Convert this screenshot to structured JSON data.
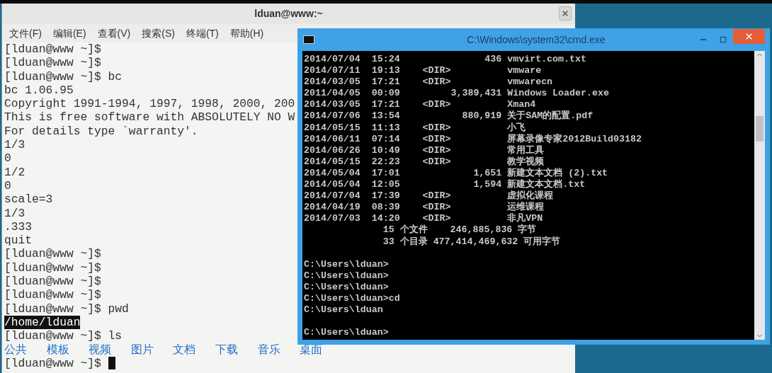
{
  "terminal": {
    "title": "lduan@www:~",
    "menu": [
      "文件(F)",
      "编辑(E)",
      "查看(V)",
      "搜索(S)",
      "终端(T)",
      "帮助(H)"
    ],
    "lines": [
      {
        "kind": "text",
        "text": "[lduan@www ~]$"
      },
      {
        "kind": "text",
        "text": "[lduan@www ~]$"
      },
      {
        "kind": "text",
        "text": "[lduan@www ~]$ bc"
      },
      {
        "kind": "text",
        "text": "bc 1.06.95"
      },
      {
        "kind": "text",
        "text": "Copyright 1991-1994, 1997, 1998, 2000, 200"
      },
      {
        "kind": "text",
        "text": "This is free software with ABSOLUTELY NO W"
      },
      {
        "kind": "text",
        "text": "For details type `warranty'."
      },
      {
        "kind": "text",
        "text": "1/3"
      },
      {
        "kind": "text",
        "text": "0"
      },
      {
        "kind": "text",
        "text": "1/2"
      },
      {
        "kind": "text",
        "text": "0"
      },
      {
        "kind": "text",
        "text": "scale=3"
      },
      {
        "kind": "text",
        "text": "1/3"
      },
      {
        "kind": "text",
        "text": ".333"
      },
      {
        "kind": "text",
        "text": "quit"
      },
      {
        "kind": "text",
        "text": "[lduan@www ~]$"
      },
      {
        "kind": "text",
        "text": "[lduan@www ~]$"
      },
      {
        "kind": "text",
        "text": "[lduan@www ~]$"
      },
      {
        "kind": "text",
        "text": "[lduan@www ~]$"
      },
      {
        "kind": "text",
        "text": "[lduan@www ~]$ pwd"
      },
      {
        "kind": "highlight",
        "text": "/home/lduan"
      },
      {
        "kind": "text",
        "text": "[lduan@www ~]$ ls"
      },
      {
        "kind": "listing",
        "items": [
          "公共",
          "模板",
          "视频",
          "图片",
          "文档",
          "下载",
          "音乐",
          "桌面"
        ]
      },
      {
        "kind": "prompt",
        "text": "[lduan@www ~]$",
        "cursor": true
      }
    ]
  },
  "cmd": {
    "title": "C:\\Windows\\system32\\cmd.exe",
    "blocks": [
      [
        "2014/07/04  15:24               436 vmvirt.com.txt",
        "2014/07/11  19:13    <DIR>          vmware",
        "2014/03/05  17:21    <DIR>          vmwarecn",
        "2011/04/05  00:09         3,389,431 Windows Loader.exe",
        "2014/03/05  17:21    <DIR>          Xman4",
        "2014/07/06  13:54           880,919 关于SAM的配置.pdf",
        "2014/05/15  11:13    <DIR>          小飞",
        "2014/06/11  07:14    <DIR>          屏幕录像专家2012Build03182",
        "2014/06/26  10:49    <DIR>          常用工具",
        "2014/05/15  22:23    <DIR>          教学视频",
        "2014/05/04  17:01             1,651 新建文本文档 (2).txt",
        "2014/05/04  12:05             1,594 新建文本文档.txt",
        "2014/07/04  17:39    <DIR>          虚拟化课程",
        "2014/04/19  08:39    <DIR>          运维课程",
        "2014/07/03  14:20    <DIR>          非凡VPN",
        "              15 个文件    246,885,836 字节",
        "              33 个目录 477,414,469,632 可用字节"
      ],
      [
        "C:\\Users\\lduan>",
        "C:\\Users\\lduan>",
        "C:\\Users\\lduan>",
        "C:\\Users\\lduan>cd",
        "C:\\Users\\lduan"
      ],
      [
        "C:\\Users\\lduan>"
      ]
    ]
  }
}
